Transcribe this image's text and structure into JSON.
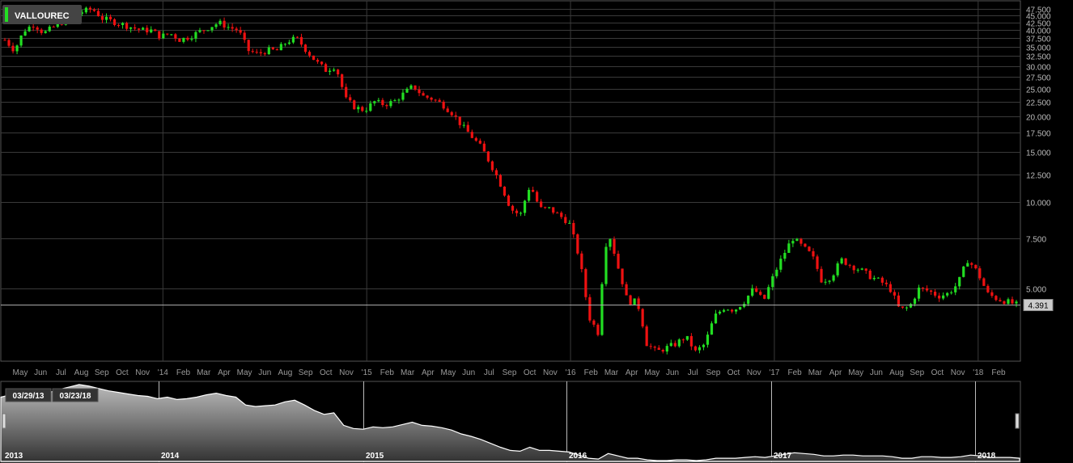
{
  "ticker": {
    "symbol": "VALLOUREC",
    "accent": "#22dd22"
  },
  "navigator": {
    "from_date": "03/29/13",
    "to_date": "03/23/18",
    "years": [
      "2013",
      "2014",
      "2015",
      "2016",
      "2017",
      "2018"
    ]
  },
  "chart_data": {
    "type": "candlestick",
    "title": "VALLOUREC",
    "y_scale": "log",
    "ylim": [
      2.5,
      50
    ],
    "y_ticks": [
      "47.500",
      "45.000",
      "42.500",
      "40.000",
      "37.500",
      "35.000",
      "32.500",
      "30.000",
      "27.500",
      "25.000",
      "22.500",
      "20.000",
      "17.500",
      "15.000",
      "12.500",
      "10.000",
      "7.500",
      "5.000"
    ],
    "y_tick_values": [
      47.5,
      45,
      42.5,
      40,
      37.5,
      35,
      32.5,
      30,
      27.5,
      25,
      22.5,
      20,
      17.5,
      15,
      12.5,
      10,
      7.5,
      5
    ],
    "x_ticks": [
      "May",
      "Jun",
      "Jul",
      "Aug",
      "Sep",
      "Oct",
      "Nov",
      "'14",
      "Feb",
      "Mar",
      "Apr",
      "May",
      "Jun",
      "Aug",
      "Sep",
      "Oct",
      "Nov",
      "'15",
      "Feb",
      "Mar",
      "Apr",
      "May",
      "Jun",
      "Jul",
      "Sep",
      "Oct",
      "Nov",
      "'16",
      "Feb",
      "Mar",
      "Apr",
      "May",
      "Jun",
      "Jul",
      "Sep",
      "Oct",
      "Nov",
      "'17",
      "Feb",
      "Mar",
      "Apr",
      "May",
      "Jun",
      "Aug",
      "Sep",
      "Oct",
      "Nov",
      "'18",
      "Feb"
    ],
    "last_price": 4.391,
    "last_price_label": "4.391",
    "grid": true,
    "up_color": "#22dd22",
    "down_color": "#ee1111",
    "close_series": [
      37.0,
      34.0,
      40.0,
      42.0,
      39.0,
      41.0,
      43.0,
      45.0,
      46.5,
      47.5,
      44.0,
      43.0,
      42.0,
      41.0,
      40.0,
      40.0,
      38.0,
      39.0,
      37.0,
      38.0,
      39.5,
      41.0,
      42.5,
      41.0,
      40.0,
      34.0,
      33.0,
      34.0,
      34.0,
      36.5,
      37.5,
      34.0,
      31.0,
      29.0,
      30.0,
      23.0,
      21.5,
      21.0,
      22.5,
      22.0,
      22.5,
      24.0,
      25.5,
      23.5,
      23.0,
      22.0,
      20.5,
      18.5,
      17.0,
      15.5,
      13.5,
      11.5,
      9.5,
      9.0,
      11.5,
      9.5,
      9.5,
      9.0,
      8.5,
      6.5,
      4.0,
      3.5,
      8.0,
      6.0,
      4.5,
      4.5,
      3.2,
      3.0,
      3.1,
      3.2,
      3.4,
      3.0,
      3.2,
      4.0,
      4.3,
      4.2,
      4.5,
      5.0,
      4.5,
      5.5,
      6.5,
      7.5,
      7.0,
      6.5,
      5.3,
      5.5,
      6.3,
      6.0,
      5.8,
      5.5,
      5.3,
      5.0,
      4.2,
      4.3,
      5.0,
      4.9,
      4.7,
      4.8,
      5.2,
      6.3,
      5.7,
      4.8,
      4.6,
      4.5,
      4.39
    ],
    "volume_profile": [
      0.82,
      0.85,
      0.9,
      0.88,
      0.84,
      0.88,
      0.92,
      0.95,
      0.98,
      0.96,
      0.93,
      0.9,
      0.88,
      0.86,
      0.84,
      0.83,
      0.8,
      0.82,
      0.79,
      0.8,
      0.82,
      0.85,
      0.87,
      0.84,
      0.82,
      0.72,
      0.7,
      0.71,
      0.72,
      0.76,
      0.78,
      0.72,
      0.65,
      0.6,
      0.62,
      0.46,
      0.42,
      0.41,
      0.44,
      0.43,
      0.44,
      0.47,
      0.5,
      0.46,
      0.45,
      0.43,
      0.4,
      0.35,
      0.32,
      0.28,
      0.23,
      0.18,
      0.14,
      0.13,
      0.18,
      0.14,
      0.14,
      0.13,
      0.12,
      0.08,
      0.04,
      0.03,
      0.1,
      0.07,
      0.04,
      0.04,
      0.02,
      0.01,
      0.01,
      0.02,
      0.02,
      0.01,
      0.02,
      0.04,
      0.04,
      0.04,
      0.05,
      0.06,
      0.05,
      0.07,
      0.09,
      0.11,
      0.1,
      0.09,
      0.07,
      0.07,
      0.08,
      0.08,
      0.07,
      0.07,
      0.07,
      0.06,
      0.04,
      0.04,
      0.06,
      0.06,
      0.05,
      0.05,
      0.06,
      0.08,
      0.07,
      0.05,
      0.05,
      0.05,
      0.04
    ]
  }
}
